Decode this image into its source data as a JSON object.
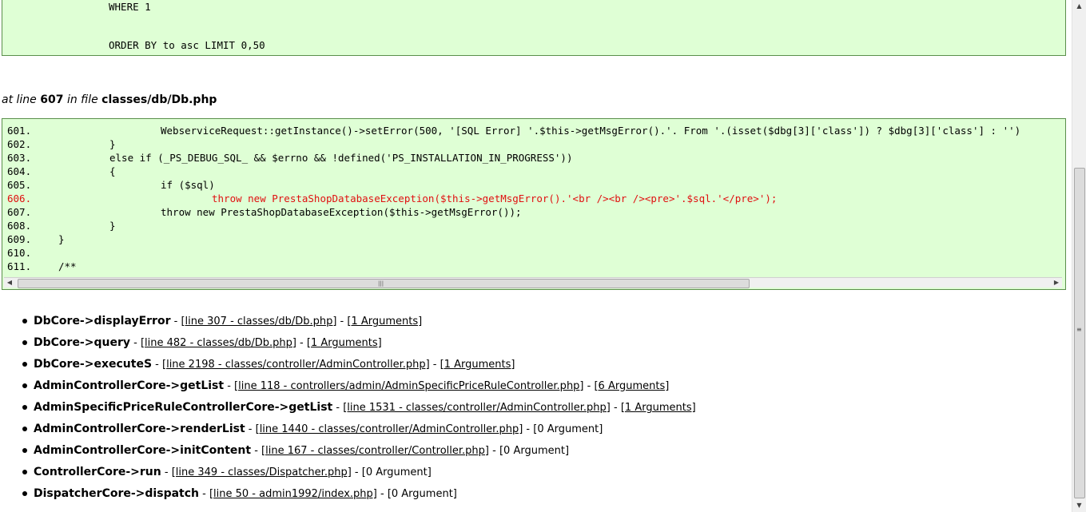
{
  "sql": {
    "line1": "WHERE 1",
    "line2": "ORDER BY to asc LIMIT 0,50"
  },
  "location": {
    "at_line_label": "at line",
    "line_number": "607",
    "in_file_label": "in file",
    "file": "classes/db/Db.php"
  },
  "code": {
    "lines": [
      {
        "num": "601.",
        "text": "WebserviceRequest::getInstance()->setError(500, '[SQL Error] '.$this->getMsgError().'. From '.(isset($dbg[3]['class']) ? $dbg[3]['class'] : '')",
        "indent": 3
      },
      {
        "num": "602.",
        "text": "}",
        "indent": 2
      },
      {
        "num": "603.",
        "text": "else if (_PS_DEBUG_SQL_ && $errno && !defined('PS_INSTALLATION_IN_PROGRESS'))",
        "indent": 2
      },
      {
        "num": "604.",
        "text": "{",
        "indent": 2
      },
      {
        "num": "605.",
        "text": "if ($sql)",
        "indent": 3
      },
      {
        "num": "606.",
        "text": "throw new PrestaShopDatabaseException($this->getMsgError().'<br /><br /><pre>'.$sql.'</pre>');",
        "indent": 4,
        "highlight": true
      },
      {
        "num": "607.",
        "text": "throw new PrestaShopDatabaseException($this->getMsgError());",
        "indent": 3
      },
      {
        "num": "608.",
        "text": "}",
        "indent": 2
      },
      {
        "num": "609.",
        "text": "}",
        "indent": 1
      },
      {
        "num": "610.",
        "text": "",
        "indent": 0
      },
      {
        "num": "611.",
        "text": "/**",
        "indent": 1
      }
    ]
  },
  "trace": [
    {
      "fn": "DbCore->displayError",
      "file_link": "[line 307 - classes/db/Db.php]",
      "args": "[1 Arguments]",
      "args_link": true
    },
    {
      "fn": "DbCore->query",
      "file_link": "[line 482 - classes/db/Db.php]",
      "args": "[1 Arguments]",
      "args_link": true
    },
    {
      "fn": "DbCore->executeS",
      "file_link": "[line 2198 - classes/controller/AdminController.php]",
      "args": "[1 Arguments]",
      "args_link": true
    },
    {
      "fn": "AdminControllerCore->getList",
      "file_link": "[line 118 - controllers/admin/AdminSpecificPriceRuleController.php]",
      "args": "[6 Arguments]",
      "args_link": true
    },
    {
      "fn": "AdminSpecificPriceRuleControllerCore->getList",
      "file_link": "[line 1531 - classes/controller/AdminController.php]",
      "args": "[1 Arguments]",
      "args_link": true
    },
    {
      "fn": "AdminControllerCore->renderList",
      "file_link": "[line 1440 - classes/controller/AdminController.php]",
      "args": "[0 Argument]",
      "args_link": false
    },
    {
      "fn": "AdminControllerCore->initContent",
      "file_link": "[line 167 - classes/controller/Controller.php]",
      "args": "[0 Argument]",
      "args_link": false
    },
    {
      "fn": "ControllerCore->run",
      "file_link": "[line 349 - classes/Dispatcher.php]",
      "args": "[0 Argument]",
      "args_link": false
    },
    {
      "fn": "DispatcherCore->dispatch",
      "file_link": "[line 50 - admin1992/index.php]",
      "args": "[0 Argument]",
      "args_link": false
    }
  ],
  "separator": " - "
}
